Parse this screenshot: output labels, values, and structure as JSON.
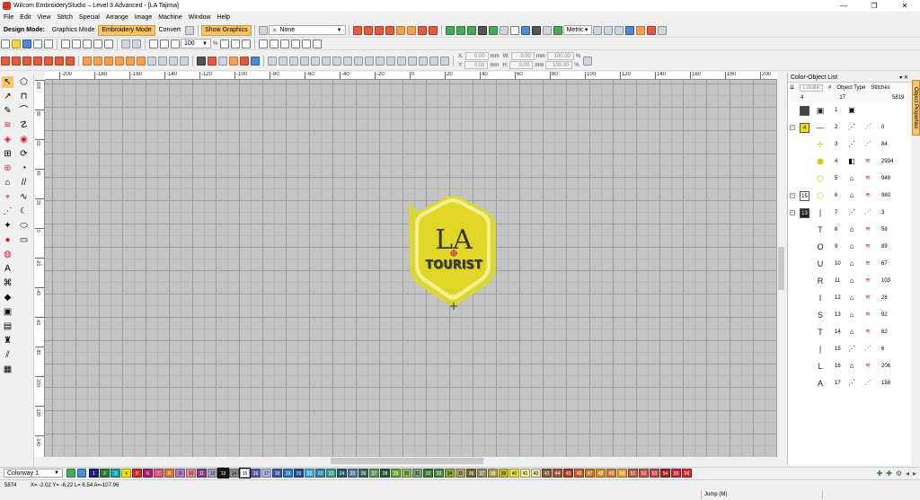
{
  "window": {
    "title": "Wilcom EmbroideryStudio – Level 3 Advanced - [LA      Tajima]",
    "minimize_glyph": "—",
    "maximize_glyph": "❐",
    "close_glyph": "✕"
  },
  "menu": [
    "File",
    "Edit",
    "View",
    "Stitch",
    "Special",
    "Arrange",
    "Image",
    "Machine",
    "Window",
    "Help"
  ],
  "toolbar": {
    "design_mode_label": "Design Mode:",
    "graphics_mode": "Graphics Mode",
    "embroidery_mode": "Embroidery Mode",
    "convert": "Convert",
    "show_graphics": "Show Graphics",
    "fabric_value": "None",
    "zoom_value": "100",
    "zoom_unit": "%",
    "units_value": "Metric",
    "x_label": "X:",
    "y_label": "Y:",
    "x_value": "0.00",
    "y_value": "0.00",
    "w_label": "W:",
    "h_label": "H:",
    "w_value": "0.00",
    "h_value": "0.00",
    "mm": "mm",
    "scale_w": "100.00",
    "scale_h": "100.00",
    "pct": "%"
  },
  "ruler": {
    "h_labels": [
      "-200",
      "-180",
      "-160",
      "-140",
      "-120",
      "-100",
      "-80",
      "-60",
      "-40",
      "-20",
      "0",
      "20",
      "40",
      "60",
      "80",
      "100",
      "120",
      "140",
      "160",
      "180",
      "200"
    ],
    "v_labels": [
      "100",
      "80",
      "60",
      "40",
      "20",
      "0",
      "-20",
      "-40",
      "-60",
      "-80",
      "-100",
      "-120",
      "-140",
      "-160"
    ]
  },
  "design": {
    "text_top": "LA",
    "text_bottom": "TOURIST",
    "colors": {
      "fill": "#e3da2a",
      "border": "#c8c81c",
      "outline": "#f3ef8a",
      "text": "#3a372e",
      "text_shadow": "#6b6a3a"
    }
  },
  "panel": {
    "title": "Color-Object List",
    "pin_glyph": "▾ ✕",
    "col_locate": "Locate",
    "col_hash": "#",
    "col_type": "Object Type",
    "col_stitches": "Stitches",
    "header_colors": "4",
    "header_objects": "17",
    "header_total": "5819",
    "rows": [
      {
        "chip": "",
        "chip_color": "#444444",
        "num": "1",
        "stitches": "",
        "type_icon": "image-icon"
      },
      {
        "chip": "4",
        "chip_color": "#f4e100",
        "num": "2",
        "stitches": "0",
        "type_icon": "run-icon"
      },
      {
        "chip": "",
        "chip_color": "",
        "num": "3",
        "stitches": "84",
        "type_icon": "run-icon"
      },
      {
        "chip": "",
        "chip_color": "",
        "num": "4",
        "stitches": "2934",
        "type_icon": "complex-fill-icon"
      },
      {
        "chip": "",
        "chip_color": "",
        "num": "5",
        "stitches": "949",
        "type_icon": "satin-icon"
      },
      {
        "chip": "15",
        "chip_color": "#ffffff",
        "num": "6",
        "stitches": "980",
        "type_icon": "satin-icon"
      },
      {
        "chip": "13",
        "chip_color": "#222222",
        "num": "7",
        "stitches": "3",
        "type_icon": "run-icon"
      },
      {
        "chip": "",
        "chip_color": "",
        "num": "8",
        "stitches": "58",
        "type_icon": "satin-icon"
      },
      {
        "chip": "",
        "chip_color": "",
        "num": "9",
        "stitches": "89",
        "type_icon": "satin-icon"
      },
      {
        "chip": "",
        "chip_color": "",
        "num": "10",
        "stitches": "67",
        "type_icon": "satin-icon"
      },
      {
        "chip": "",
        "chip_color": "",
        "num": "11",
        "stitches": "103",
        "type_icon": "satin-icon"
      },
      {
        "chip": "",
        "chip_color": "",
        "num": "12",
        "stitches": "28",
        "type_icon": "satin-icon"
      },
      {
        "chip": "",
        "chip_color": "",
        "num": "13",
        "stitches": "92",
        "type_icon": "satin-icon"
      },
      {
        "chip": "",
        "chip_color": "",
        "num": "14",
        "stitches": "62",
        "type_icon": "satin-icon"
      },
      {
        "chip": "",
        "chip_color": "",
        "num": "15",
        "stitches": "6",
        "type_icon": "run-icon"
      },
      {
        "chip": "",
        "chip_color": "",
        "num": "16",
        "stitches": "206",
        "type_icon": "satin-icon"
      },
      {
        "chip": "",
        "chip_color": "",
        "num": "17",
        "stitches": "158",
        "type_icon": "run-icon"
      }
    ],
    "side_tab": "Object Properties"
  },
  "colorway": {
    "select_value": "Colorway 1",
    "swatches": [
      {
        "n": "1",
        "c": "#1f1f7a"
      },
      {
        "n": "2",
        "c": "#2f7d32"
      },
      {
        "n": "3",
        "c": "#19a3b0"
      },
      {
        "n": "4",
        "c": "#f2e100"
      },
      {
        "n": "5",
        "c": "#d02a2a"
      },
      {
        "n": "6",
        "c": "#b01e6e"
      },
      {
        "n": "7",
        "c": "#e0567a"
      },
      {
        "n": "8",
        "c": "#e07c2a"
      },
      {
        "n": "9",
        "c": "#b07cc8"
      },
      {
        "n": "10",
        "c": "#e48c8c"
      },
      {
        "n": "11",
        "c": "#8a3c8a"
      },
      {
        "n": "12",
        "c": "#a0a0c8"
      },
      {
        "n": "13",
        "c": "#1a1a1a"
      },
      {
        "n": "14",
        "c": "#8c8c8c"
      },
      {
        "n": "15",
        "c": "#ffffff"
      },
      {
        "n": "16",
        "c": "#5a5ab8"
      },
      {
        "n": "17",
        "c": "#a8b8e0"
      },
      {
        "n": "18",
        "c": "#3c5ab0"
      },
      {
        "n": "19",
        "c": "#2a7ac8"
      },
      {
        "n": "20",
        "c": "#1e4ea0"
      },
      {
        "n": "21",
        "c": "#4aa8d8"
      },
      {
        "n": "22",
        "c": "#2a8aa8"
      },
      {
        "n": "23",
        "c": "#3a9a9a"
      },
      {
        "n": "24",
        "c": "#206060"
      },
      {
        "n": "25",
        "c": "#5a7aa0"
      },
      {
        "n": "26",
        "c": "#3a6a5a"
      },
      {
        "n": "27",
        "c": "#5aa05a"
      },
      {
        "n": "28",
        "c": "#2a5a3a"
      },
      {
        "n": "29",
        "c": "#6aa83a"
      },
      {
        "n": "30",
        "c": "#8ab85a"
      },
      {
        "n": "31",
        "c": "#7aa07a"
      },
      {
        "n": "32",
        "c": "#3a7a3a"
      },
      {
        "n": "33",
        "c": "#4a8a4a"
      },
      {
        "n": "34",
        "c": "#8aa83a"
      },
      {
        "n": "35",
        "c": "#a8a86a"
      },
      {
        "n": "36",
        "c": "#6a6a3a"
      },
      {
        "n": "37",
        "c": "#9a8a6a"
      },
      {
        "n": "38",
        "c": "#b0a050"
      },
      {
        "n": "39",
        "c": "#c8b820"
      },
      {
        "n": "40",
        "c": "#e8e040"
      },
      {
        "n": "41",
        "c": "#f0e890"
      },
      {
        "n": "42",
        "c": "#e8e0b0"
      },
      {
        "n": "43",
        "c": "#8a5a3a"
      },
      {
        "n": "44",
        "c": "#a05a3a"
      },
      {
        "n": "45",
        "c": "#b0402a"
      },
      {
        "n": "46",
        "c": "#c8602a"
      },
      {
        "n": "47",
        "c": "#d0782a"
      },
      {
        "n": "48",
        "c": "#e0902a"
      },
      {
        "n": "49",
        "c": "#d0803a"
      },
      {
        "n": "50",
        "c": "#e8a03a"
      },
      {
        "n": "51",
        "c": "#c06040"
      },
      {
        "n": "52",
        "c": "#d05040"
      },
      {
        "n": "53",
        "c": "#c84848"
      },
      {
        "n": "54",
        "c": "#a02828"
      },
      {
        "n": "55",
        "c": "#c82838"
      },
      {
        "n": "56",
        "c": "#e02828"
      }
    ]
  },
  "status": {
    "stitch_count": "5874",
    "coords": "X=  -2.02  Y=  -6.22  L=   6.54  A=-107.96",
    "mode": "Jump (M)"
  }
}
